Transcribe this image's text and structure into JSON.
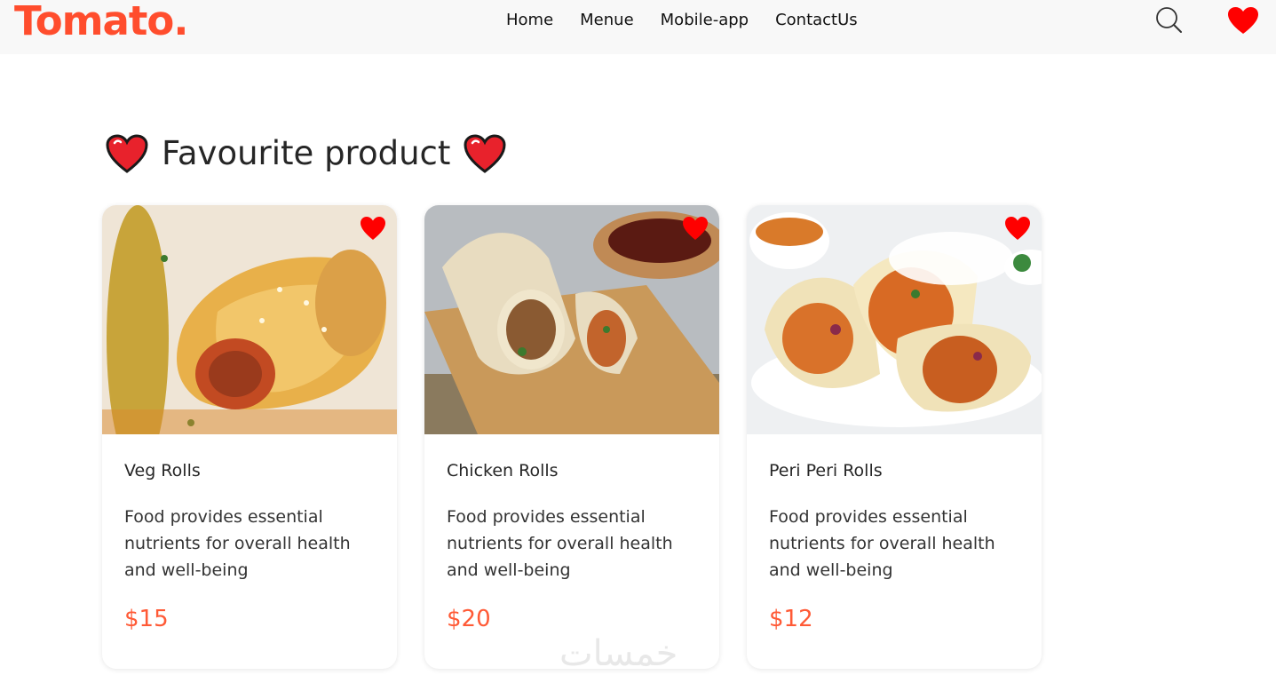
{
  "brand": {
    "logo": "Tomato.",
    "accent_color": "#ff4d2d",
    "price_color": "#ff5a36",
    "heart_color": "#ff0000"
  },
  "nav": {
    "links": [
      "Home",
      "Menue",
      "Mobile-app",
      "ContactUs"
    ],
    "icons": [
      "search-icon",
      "heart-icon"
    ]
  },
  "section": {
    "title": "Favourite product",
    "title_icon": "heart-icon"
  },
  "products": [
    {
      "name": "Veg Rolls",
      "description": "Food provides essential nutrients for overall health and well-being",
      "price": "$15",
      "image": "veg-rolls-image",
      "favourite": true
    },
    {
      "name": "Chicken Rolls",
      "description": "Food provides essential nutrients for overall health and well-being",
      "price": "$20",
      "image": "chicken-rolls-image",
      "favourite": true
    },
    {
      "name": "Peri Peri Rolls",
      "description": "Food provides essential nutrients for overall health and well-being",
      "price": "$12",
      "image": "peri-peri-rolls-image",
      "favourite": true
    }
  ],
  "watermark": "خمسات"
}
